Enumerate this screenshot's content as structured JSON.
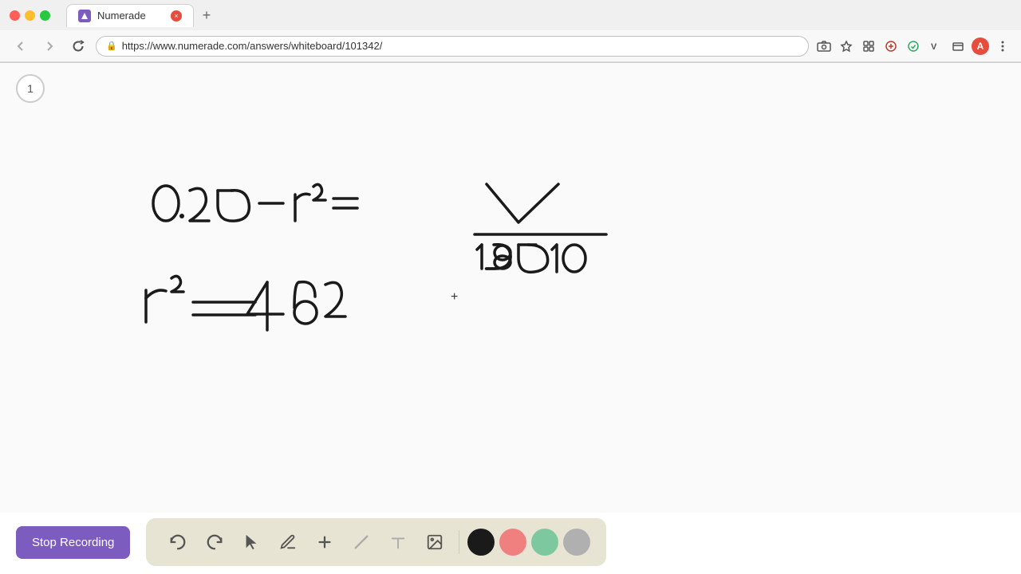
{
  "browser": {
    "tab_title": "Numerade",
    "tab_close": "×",
    "new_tab": "+",
    "url": "https://www.numerade.com/answers/whiteboard/101342/",
    "nav": {
      "back": "‹",
      "forward": "›",
      "refresh": "↺"
    },
    "actions": {
      "camera": "📷",
      "bookmark": "☆",
      "extensions1": "⬡",
      "extensions2": "⬡",
      "star": "★",
      "extension3": "⬡",
      "extension4": "V",
      "window": "⬜",
      "profile": "A",
      "menu": "⋮"
    }
  },
  "whiteboard": {
    "page_number": "1",
    "cursor": "+"
  },
  "toolbar": {
    "undo_label": "↺",
    "redo_label": "↻",
    "select_label": "▲",
    "pen_label": "✏",
    "add_label": "+",
    "eraser_label": "/",
    "text_label": "A",
    "image_label": "🖼",
    "colors": [
      "#1a1a1a",
      "#f08080",
      "#7ec8a0",
      "#b8b8b8"
    ]
  },
  "bottom": {
    "stop_recording_label": "Stop Recording"
  }
}
